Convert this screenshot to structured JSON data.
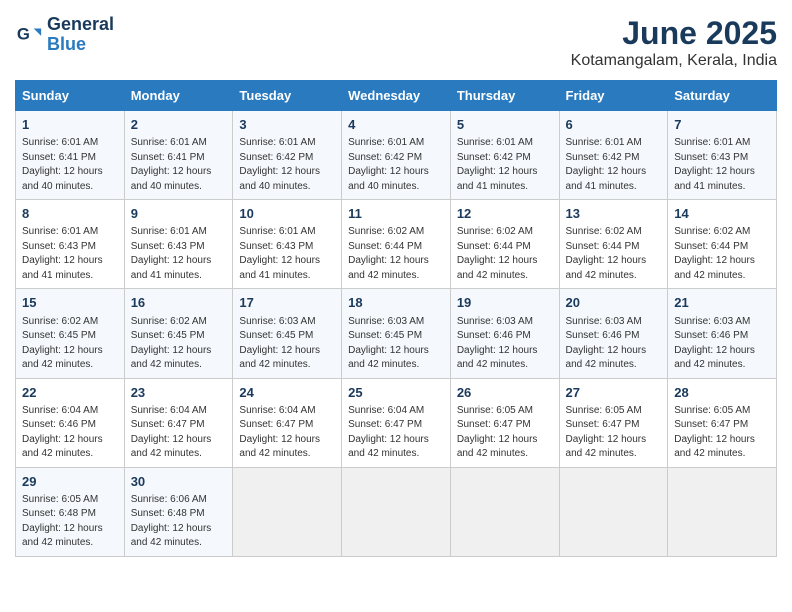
{
  "logo": {
    "line1": "General",
    "line2": "Blue"
  },
  "title": "June 2025",
  "location": "Kotamangalam, Kerala, India",
  "days_of_week": [
    "Sunday",
    "Monday",
    "Tuesday",
    "Wednesday",
    "Thursday",
    "Friday",
    "Saturday"
  ],
  "weeks": [
    [
      {
        "day": "1",
        "info": "Sunrise: 6:01 AM\nSunset: 6:41 PM\nDaylight: 12 hours\nand 40 minutes."
      },
      {
        "day": "2",
        "info": "Sunrise: 6:01 AM\nSunset: 6:41 PM\nDaylight: 12 hours\nand 40 minutes."
      },
      {
        "day": "3",
        "info": "Sunrise: 6:01 AM\nSunset: 6:42 PM\nDaylight: 12 hours\nand 40 minutes."
      },
      {
        "day": "4",
        "info": "Sunrise: 6:01 AM\nSunset: 6:42 PM\nDaylight: 12 hours\nand 40 minutes."
      },
      {
        "day": "5",
        "info": "Sunrise: 6:01 AM\nSunset: 6:42 PM\nDaylight: 12 hours\nand 41 minutes."
      },
      {
        "day": "6",
        "info": "Sunrise: 6:01 AM\nSunset: 6:42 PM\nDaylight: 12 hours\nand 41 minutes."
      },
      {
        "day": "7",
        "info": "Sunrise: 6:01 AM\nSunset: 6:43 PM\nDaylight: 12 hours\nand 41 minutes."
      }
    ],
    [
      {
        "day": "8",
        "info": "Sunrise: 6:01 AM\nSunset: 6:43 PM\nDaylight: 12 hours\nand 41 minutes."
      },
      {
        "day": "9",
        "info": "Sunrise: 6:01 AM\nSunset: 6:43 PM\nDaylight: 12 hours\nand 41 minutes."
      },
      {
        "day": "10",
        "info": "Sunrise: 6:01 AM\nSunset: 6:43 PM\nDaylight: 12 hours\nand 41 minutes."
      },
      {
        "day": "11",
        "info": "Sunrise: 6:02 AM\nSunset: 6:44 PM\nDaylight: 12 hours\nand 42 minutes."
      },
      {
        "day": "12",
        "info": "Sunrise: 6:02 AM\nSunset: 6:44 PM\nDaylight: 12 hours\nand 42 minutes."
      },
      {
        "day": "13",
        "info": "Sunrise: 6:02 AM\nSunset: 6:44 PM\nDaylight: 12 hours\nand 42 minutes."
      },
      {
        "day": "14",
        "info": "Sunrise: 6:02 AM\nSunset: 6:44 PM\nDaylight: 12 hours\nand 42 minutes."
      }
    ],
    [
      {
        "day": "15",
        "info": "Sunrise: 6:02 AM\nSunset: 6:45 PM\nDaylight: 12 hours\nand 42 minutes."
      },
      {
        "day": "16",
        "info": "Sunrise: 6:02 AM\nSunset: 6:45 PM\nDaylight: 12 hours\nand 42 minutes."
      },
      {
        "day": "17",
        "info": "Sunrise: 6:03 AM\nSunset: 6:45 PM\nDaylight: 12 hours\nand 42 minutes."
      },
      {
        "day": "18",
        "info": "Sunrise: 6:03 AM\nSunset: 6:45 PM\nDaylight: 12 hours\nand 42 minutes."
      },
      {
        "day": "19",
        "info": "Sunrise: 6:03 AM\nSunset: 6:46 PM\nDaylight: 12 hours\nand 42 minutes."
      },
      {
        "day": "20",
        "info": "Sunrise: 6:03 AM\nSunset: 6:46 PM\nDaylight: 12 hours\nand 42 minutes."
      },
      {
        "day": "21",
        "info": "Sunrise: 6:03 AM\nSunset: 6:46 PM\nDaylight: 12 hours\nand 42 minutes."
      }
    ],
    [
      {
        "day": "22",
        "info": "Sunrise: 6:04 AM\nSunset: 6:46 PM\nDaylight: 12 hours\nand 42 minutes."
      },
      {
        "day": "23",
        "info": "Sunrise: 6:04 AM\nSunset: 6:47 PM\nDaylight: 12 hours\nand 42 minutes."
      },
      {
        "day": "24",
        "info": "Sunrise: 6:04 AM\nSunset: 6:47 PM\nDaylight: 12 hours\nand 42 minutes."
      },
      {
        "day": "25",
        "info": "Sunrise: 6:04 AM\nSunset: 6:47 PM\nDaylight: 12 hours\nand 42 minutes."
      },
      {
        "day": "26",
        "info": "Sunrise: 6:05 AM\nSunset: 6:47 PM\nDaylight: 12 hours\nand 42 minutes."
      },
      {
        "day": "27",
        "info": "Sunrise: 6:05 AM\nSunset: 6:47 PM\nDaylight: 12 hours\nand 42 minutes."
      },
      {
        "day": "28",
        "info": "Sunrise: 6:05 AM\nSunset: 6:47 PM\nDaylight: 12 hours\nand 42 minutes."
      }
    ],
    [
      {
        "day": "29",
        "info": "Sunrise: 6:05 AM\nSunset: 6:48 PM\nDaylight: 12 hours\nand 42 minutes."
      },
      {
        "day": "30",
        "info": "Sunrise: 6:06 AM\nSunset: 6:48 PM\nDaylight: 12 hours\nand 42 minutes."
      },
      {
        "day": "",
        "info": ""
      },
      {
        "day": "",
        "info": ""
      },
      {
        "day": "",
        "info": ""
      },
      {
        "day": "",
        "info": ""
      },
      {
        "day": "",
        "info": ""
      }
    ]
  ]
}
